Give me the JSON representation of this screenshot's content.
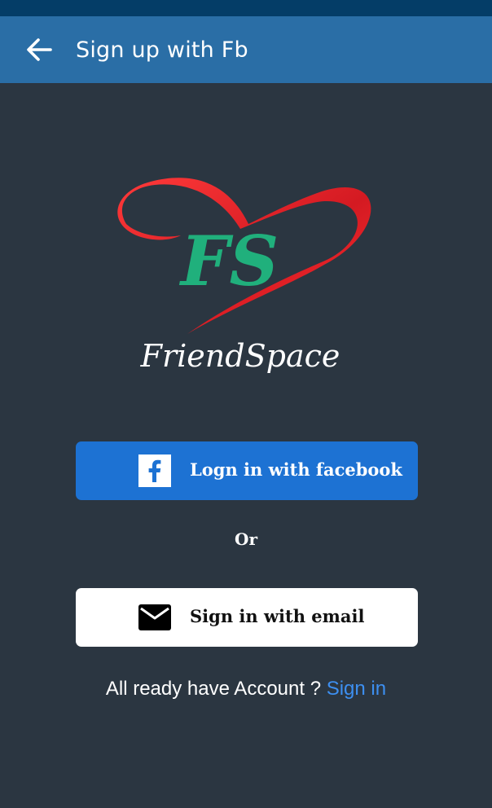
{
  "app_bar": {
    "title": "Sign up with Fb",
    "back_icon": "arrow-left-icon"
  },
  "logo": {
    "initials": "FS",
    "wordmark": "FriendSpace",
    "heart_color": "#e0252b",
    "initials_color": "#20b07c"
  },
  "facebook_button": {
    "label": "Logn in with facebook",
    "icon": "facebook-icon",
    "color": "#1d72d3"
  },
  "separator": "Or",
  "email_button": {
    "label": "Sign in with email",
    "icon": "mail-icon"
  },
  "footer": {
    "prompt": "All ready have Account ? ",
    "signin_label": "Sign in",
    "link_color": "#3d8ff0"
  }
}
